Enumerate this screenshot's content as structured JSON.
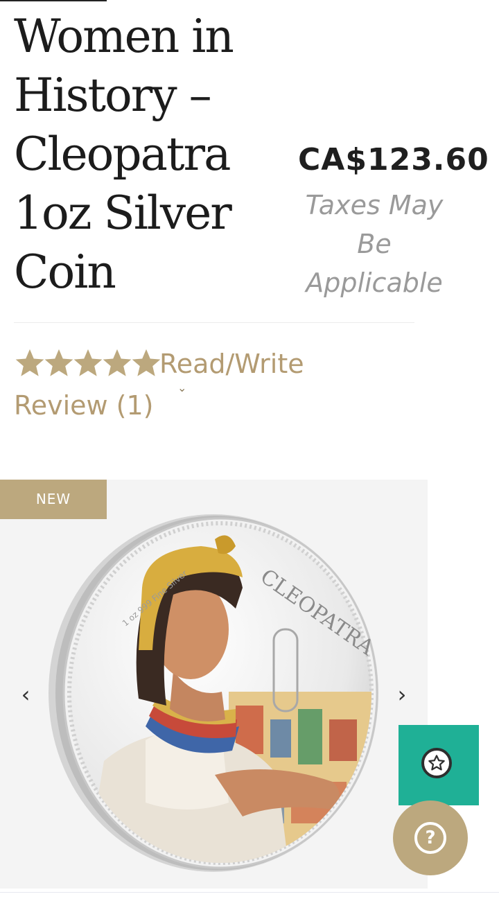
{
  "product": {
    "title": "Women in History – Cleopatra 1oz Silver Coin",
    "price": "CA$123.60",
    "tax_note": "Taxes May Be Applicable"
  },
  "rating": {
    "stars": 5,
    "max_stars": 5,
    "review_link_line1": "Read/Write",
    "review_link_line2": "Review (1)",
    "color": "#bca87e"
  },
  "gallery": {
    "badge": "NEW",
    "coin_legend_top": "CLEOPATRA",
    "coin_legend_left": "1 oz 999 Fine Silver",
    "prev_icon": "chevron-left-icon",
    "next_icon": "chevron-right-icon"
  },
  "widgets": {
    "reviews_icon": "star-badge-icon",
    "reviews_color": "#1fb096",
    "help_icon": "question-mark-icon",
    "help_label": "?",
    "help_color": "#bca87e"
  }
}
